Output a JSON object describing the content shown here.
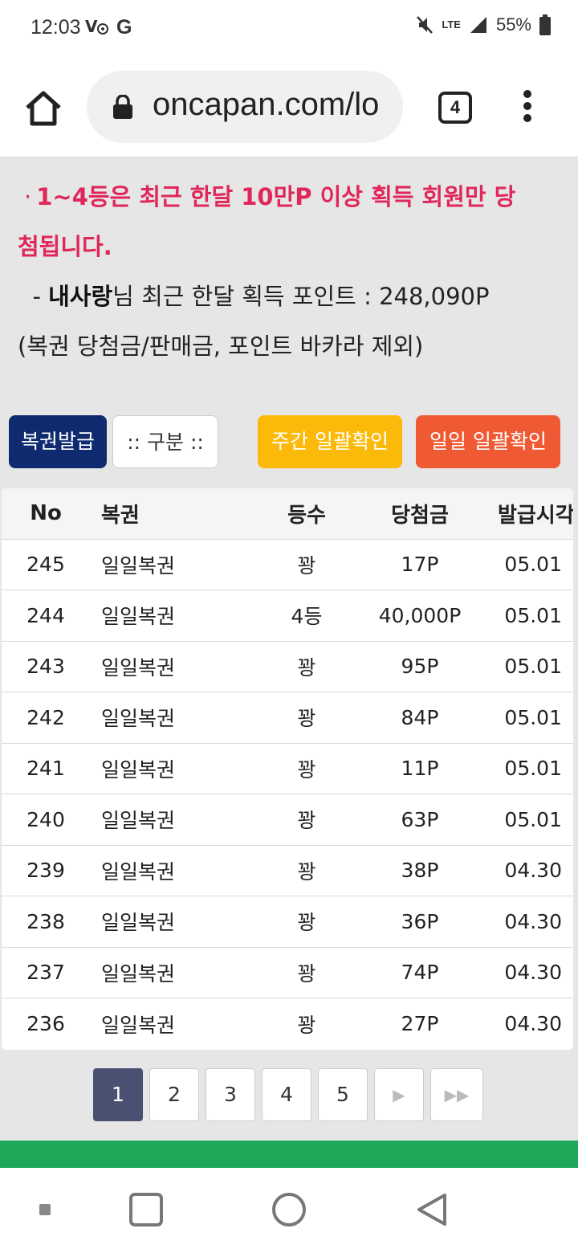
{
  "status_bar": {
    "time": "12:03",
    "left_icons": [
      "volte-icon",
      "google-icon"
    ],
    "right_icons": [
      "mute-icon",
      "lte-icon",
      "signal-icon",
      "battery-icon"
    ],
    "network": "LTE",
    "battery": "55%"
  },
  "browser": {
    "url": "oncapan.com/lo",
    "tab_count": "4"
  },
  "notice": {
    "bullet": "·",
    "highlight_line1": "1~4등은 최근 한달 10만P 이상 획득 회원만 당",
    "highlight_line2": "첨됩니다.",
    "points_prefix": "- ",
    "user_name": "내사랑",
    "points_label": "님 최근 한달 획득 포인트 : ",
    "points_value": "248,090P",
    "exclusion": "(복권 당첨금/판매금, 포인트 바카라 제외)"
  },
  "buttons": {
    "issue": "복권발급",
    "category": ":: 구분 ::",
    "weekly_check": "주간 일괄확인",
    "daily_check": "일일 일괄확인"
  },
  "table": {
    "headers": [
      "No",
      "복권",
      "등수",
      "당첨금",
      "발급시각"
    ],
    "rows": [
      [
        "245",
        "일일복권",
        "꽝",
        "17P",
        "05.01"
      ],
      [
        "244",
        "일일복권",
        "4등",
        "40,000P",
        "05.01"
      ],
      [
        "243",
        "일일복권",
        "꽝",
        "95P",
        "05.01"
      ],
      [
        "242",
        "일일복권",
        "꽝",
        "84P",
        "05.01"
      ],
      [
        "241",
        "일일복권",
        "꽝",
        "11P",
        "05.01"
      ],
      [
        "240",
        "일일복권",
        "꽝",
        "63P",
        "05.01"
      ],
      [
        "239",
        "일일복권",
        "꽝",
        "38P",
        "04.30"
      ],
      [
        "238",
        "일일복권",
        "꽝",
        "36P",
        "04.30"
      ],
      [
        "237",
        "일일복권",
        "꽝",
        "74P",
        "04.30"
      ],
      [
        "236",
        "일일복권",
        "꽝",
        "27P",
        "04.30"
      ]
    ]
  },
  "pagination": {
    "pages": [
      "1",
      "2",
      "3",
      "4",
      "5"
    ],
    "current": "1",
    "next_icon": "▶",
    "last_icon": "▶▶"
  },
  "colors": {
    "highlight_red": "#e0275a",
    "issue_button": "#0f2a6e",
    "weekly_button": "#fbba0a",
    "daily_button": "#ef5a34",
    "active_page": "#4a5071",
    "green_bar": "#1fa75a"
  },
  "nav_bar": {
    "icons": [
      "recents-small-icon",
      "overview-icon",
      "home-circle-icon",
      "back-icon"
    ]
  }
}
